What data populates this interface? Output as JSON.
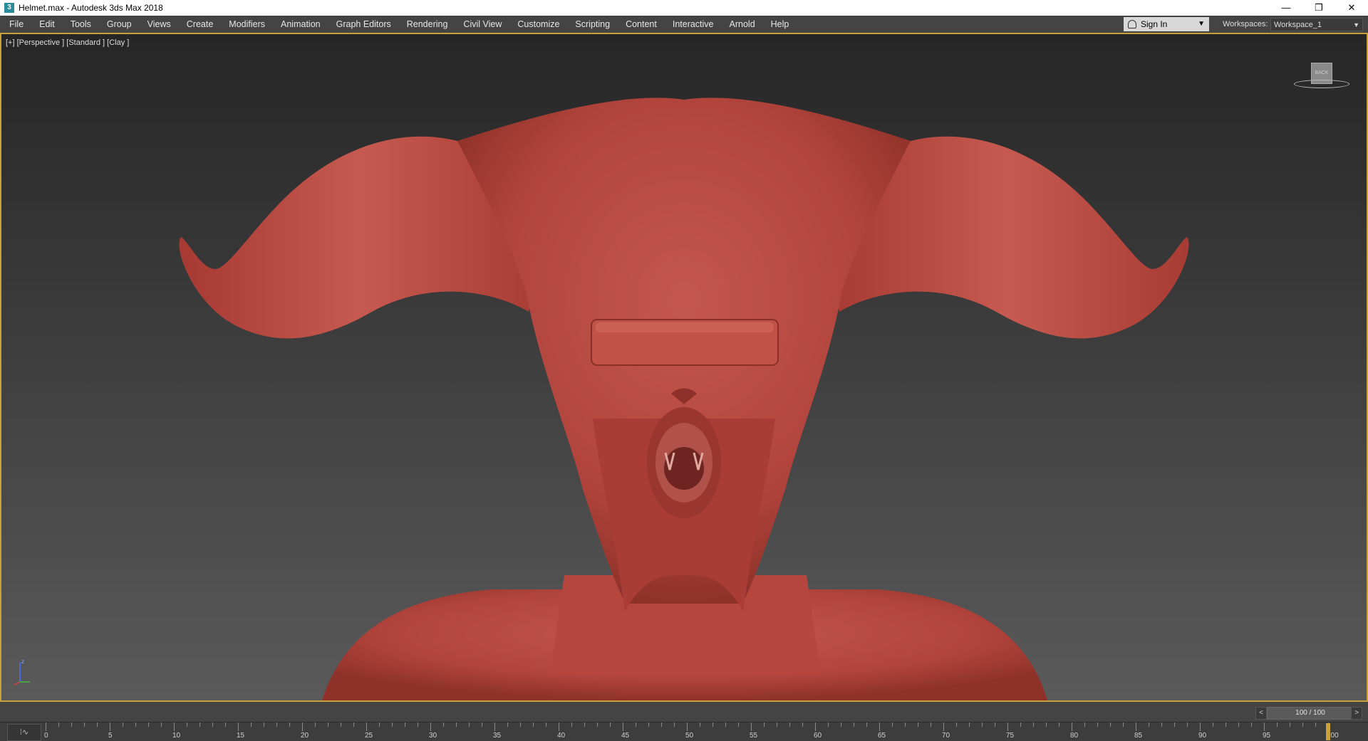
{
  "window": {
    "title": "Helmet.max - Autodesk 3ds Max 2018",
    "app_icon": "3",
    "controls": {
      "minimize": "—",
      "restore": "❐",
      "close": "✕"
    }
  },
  "menubar": {
    "items": [
      "File",
      "Edit",
      "Tools",
      "Group",
      "Views",
      "Create",
      "Modifiers",
      "Animation",
      "Graph Editors",
      "Rendering",
      "Civil View",
      "Customize",
      "Scripting",
      "Content",
      "Interactive",
      "Arnold",
      "Help"
    ]
  },
  "account": {
    "signin_label": "Sign In",
    "arrow": "▼"
  },
  "workspaces": {
    "label": "Workspaces:",
    "value": "Workspace_1",
    "arrow": "▼"
  },
  "viewport": {
    "label": "[+] [Perspective ] [Standard ] [Clay ]",
    "viewcube_face": "BACK",
    "model_color": "#b8473f",
    "border_color": "#c8a13c"
  },
  "timeline": {
    "frame_display": "100 / 100",
    "prev": "<",
    "next": ">",
    "trackbar_icon": "⁞∿",
    "ticks": [
      "0",
      "5",
      "10",
      "15",
      "20",
      "25",
      "30",
      "35",
      "40",
      "45",
      "50",
      "55",
      "60",
      "65",
      "70",
      "75",
      "80",
      "85",
      "90",
      "95",
      "100"
    ],
    "current_frame": 100
  }
}
